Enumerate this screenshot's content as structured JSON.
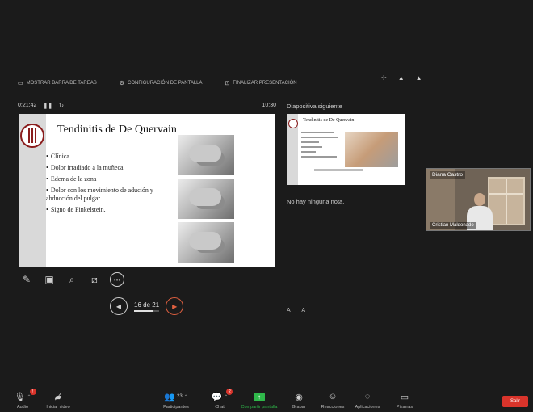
{
  "presenter_toolbar": {
    "items": [
      {
        "icon": "taskbar-icon",
        "label": "MOSTRAR BARRA DE TAREAS"
      },
      {
        "icon": "display-settings-icon",
        "label": "CONFIGURACIÓN DE PANTALLA"
      },
      {
        "icon": "end-slideshow-icon",
        "label": "FINALIZAR PRESENTACIÓN"
      }
    ]
  },
  "timer": {
    "elapsed": "0:21:42",
    "clock": "10:30"
  },
  "next_slide_label": "Diapositiva siguiente",
  "current_slide": {
    "title": "Tendinitis de De Quervain",
    "bullets": [
      "Clínica",
      "Dolor irradiado a la muñeca.",
      "Edema de la zona",
      "Dolor con los movimiento de adución y abducción del pulgar.",
      "Signo de Finkelstein."
    ]
  },
  "next_slide": {
    "title": "Tendinitis de De Quervain"
  },
  "notes_text": "No hay ninguna nota.",
  "page_indicator": {
    "text": "16 de 21",
    "current": 16,
    "total": 21
  },
  "participant": {
    "name_top": "Diana Castro",
    "name_bottom": "Cristian Maldonado"
  },
  "bottom_bar": {
    "audio": {
      "label": "Audio",
      "badge": "!"
    },
    "video": {
      "label": "Iniciar video"
    },
    "participants": {
      "label": "Participantes",
      "count": "23"
    },
    "chat": {
      "label": "Chat",
      "badge": "2"
    },
    "share": {
      "label": "Compartir pantalla"
    },
    "record": {
      "label": "Grabar"
    },
    "reactions": {
      "label": "Reacciones"
    },
    "apps": {
      "label": "Aplicaciones"
    },
    "whiteboards": {
      "label": "Pizarras"
    },
    "end": {
      "label": "Salir"
    }
  },
  "colors": {
    "accent_green": "#2fb84a",
    "end_red": "#d9342b",
    "next_orange": "#e06040"
  }
}
